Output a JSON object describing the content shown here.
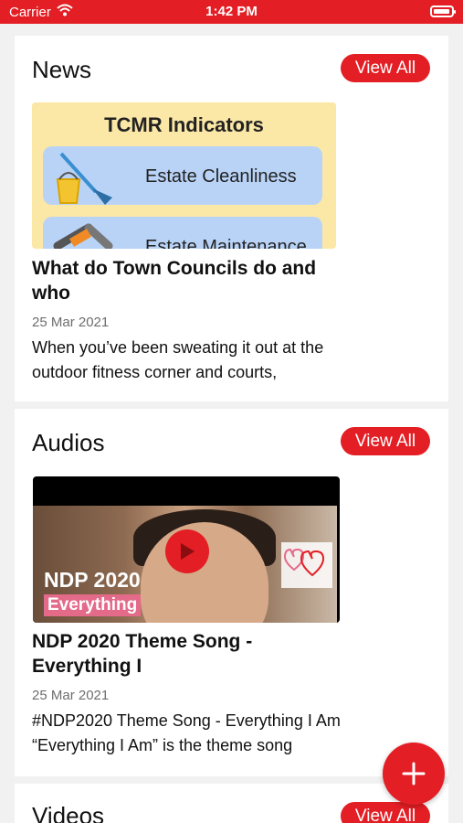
{
  "status_bar": {
    "carrier": "Carrier",
    "time": "1:42 PM",
    "battery_level": 0.95
  },
  "news": {
    "title": "News",
    "view_all_label": "View All",
    "thumbnail": {
      "heading": "TCMR Indicators",
      "rows": [
        "Estate Cleanliness",
        "Estate Maintenance"
      ]
    },
    "item": {
      "title": "What do Town Councils do and who",
      "date": "25 Mar 2021",
      "description": "When you’ve been sweating it out at the outdoor fitness corner and courts,"
    }
  },
  "audios": {
    "title": "Audios",
    "view_all_label": "View All",
    "thumbnail": {
      "caption": "NDP 2020",
      "subcaption": "Everything"
    },
    "item": {
      "title": "NDP 2020 Theme Song - Everything I",
      "date": "25 Mar 2021",
      "description": "#NDP2020 Theme Song - Everything I Am “Everything I Am” is the theme song"
    }
  },
  "videos": {
    "title": "Videos",
    "view_all_label": "View All"
  },
  "colors": {
    "accent": "#e31e24",
    "background": "#f1f1f1",
    "card": "#ffffff",
    "muted_text": "#6e6e6e"
  },
  "icons": {
    "wifi": "wifi-icon",
    "battery": "battery-icon",
    "play": "play-icon",
    "add": "plus-icon"
  }
}
